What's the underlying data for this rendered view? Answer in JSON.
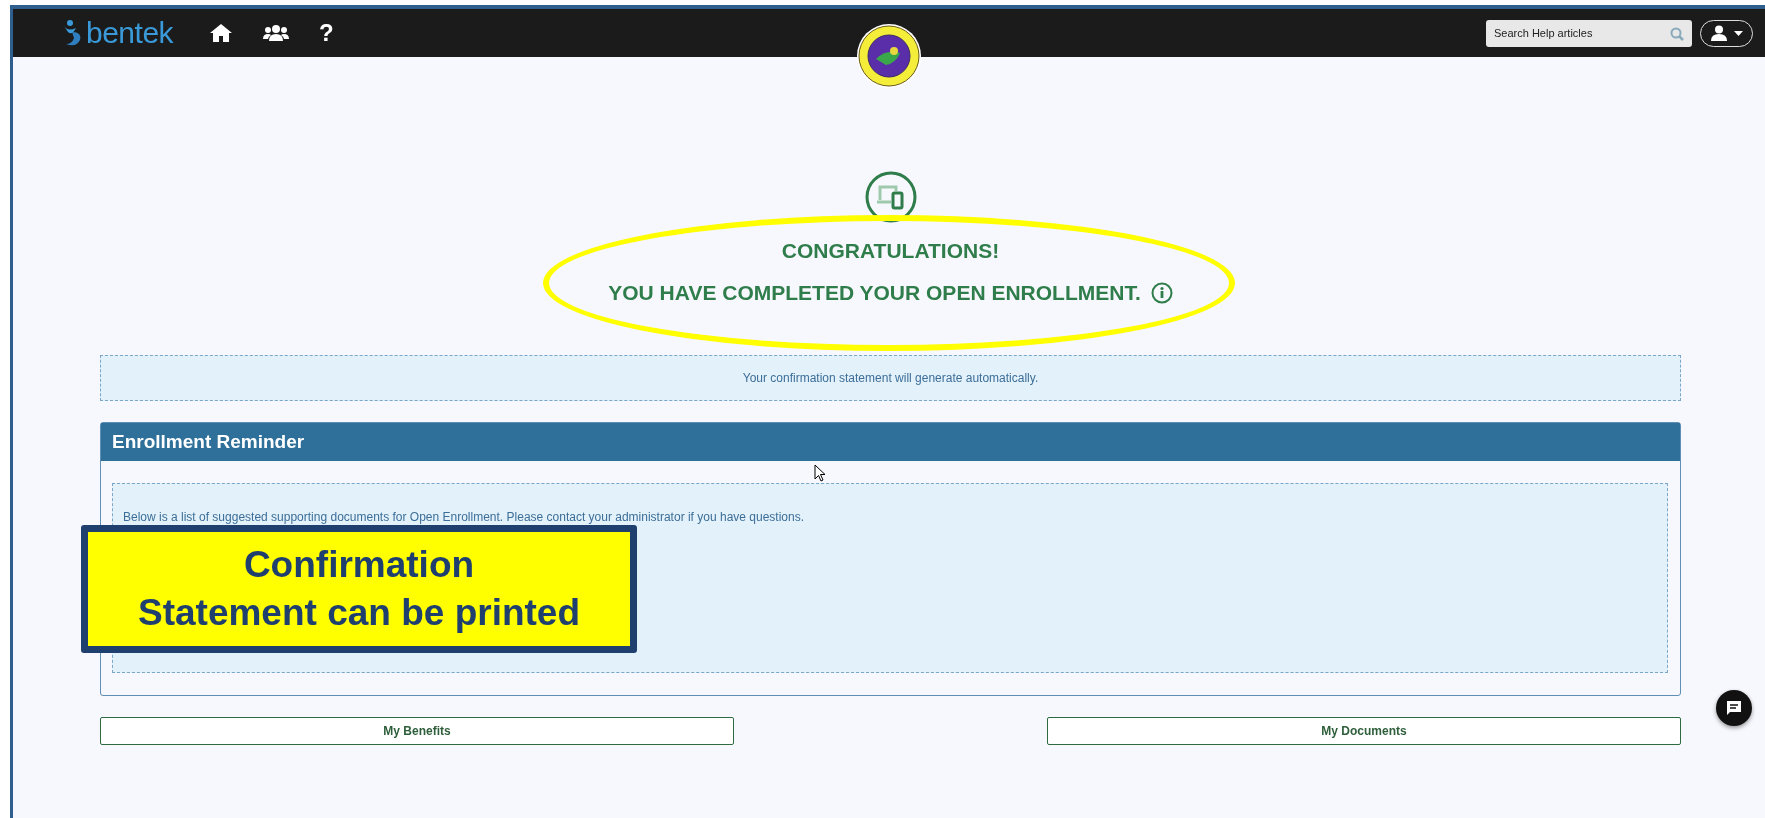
{
  "header": {
    "logo": "bentek",
    "nav": [
      {
        "kind": "home"
      },
      {
        "kind": "people"
      },
      {
        "kind": "help",
        "label": "?"
      }
    ],
    "search": {
      "placeholder": "Search Help articles"
    }
  },
  "hero": {
    "title": "CONGRATULATIONS!",
    "subtitle": "YOU HAVE COMPLETED YOUR OPEN ENROLLMENT."
  },
  "notice": "Your confirmation statement will generate automatically.",
  "panel": {
    "title": "Enrollment Reminder",
    "text": "Below is a list of suggested supporting documents for Open Enrollment. Please contact your administrator if you have questions."
  },
  "callout": "Confirmation\nStatement can be printed",
  "buttons": [
    "My Benefits",
    "My Documents"
  ]
}
